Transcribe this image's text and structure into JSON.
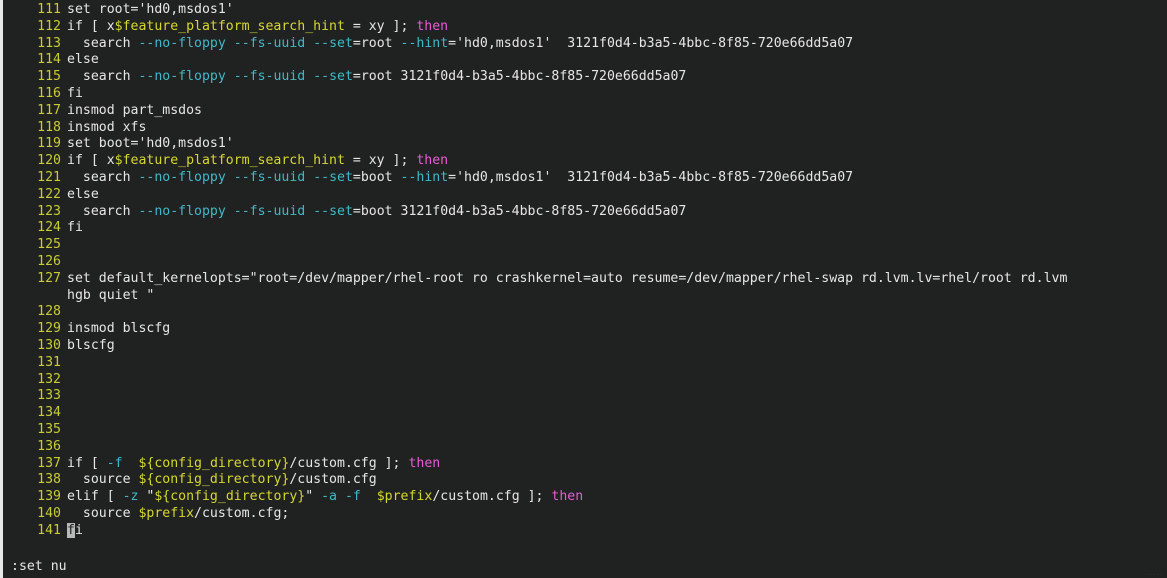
{
  "app": {
    "name": "vim",
    "background_color": "#202221",
    "foreground_color": "#e6e6e6",
    "linenumber_color": "#c9cc35",
    "keyword_color": "#e65bd4",
    "option_color": "#3fb9c9",
    "variable_color": "#d7d72f",
    "cursor_color": "#b8b8b8"
  },
  "statusline": {
    "command": ":set nu"
  },
  "watermark": {
    "text": "....."
  },
  "editor": {
    "first_line_number": 111,
    "cursor_line": 141,
    "cursor_column": 1,
    "lines": [
      {
        "num": "111",
        "spans": [
          {
            "t": "set root='hd0,msdos1'",
            "c": "plain"
          }
        ]
      },
      {
        "num": "112",
        "spans": [
          {
            "t": "if [ x",
            "c": "plain"
          },
          {
            "t": "$feature_platform_search_hint",
            "c": "var"
          },
          {
            "t": " = xy ]; ",
            "c": "plain"
          },
          {
            "t": "then",
            "c": "kw"
          }
        ]
      },
      {
        "num": "113",
        "spans": [
          {
            "t": "  search ",
            "c": "plain"
          },
          {
            "t": "--no-floppy",
            "c": "flag"
          },
          {
            "t": " ",
            "c": "plain"
          },
          {
            "t": "--fs-uuid",
            "c": "flag"
          },
          {
            "t": " ",
            "c": "plain"
          },
          {
            "t": "--set",
            "c": "flag"
          },
          {
            "t": "=root ",
            "c": "plain"
          },
          {
            "t": "--hint",
            "c": "flag"
          },
          {
            "t": "='hd0,msdos1'  3121f0d4-b3a5-4bbc-8f85-720e66dd5a07",
            "c": "plain"
          }
        ]
      },
      {
        "num": "114",
        "spans": [
          {
            "t": "else",
            "c": "plain"
          }
        ]
      },
      {
        "num": "115",
        "spans": [
          {
            "t": "  search ",
            "c": "plain"
          },
          {
            "t": "--no-floppy",
            "c": "flag"
          },
          {
            "t": " ",
            "c": "plain"
          },
          {
            "t": "--fs-uuid",
            "c": "flag"
          },
          {
            "t": " ",
            "c": "plain"
          },
          {
            "t": "--set",
            "c": "flag"
          },
          {
            "t": "=root 3121f0d4-b3a5-4bbc-8f85-720e66dd5a07",
            "c": "plain"
          }
        ]
      },
      {
        "num": "116",
        "spans": [
          {
            "t": "fi",
            "c": "plain"
          }
        ]
      },
      {
        "num": "117",
        "spans": [
          {
            "t": "insmod part_msdos",
            "c": "plain"
          }
        ]
      },
      {
        "num": "118",
        "spans": [
          {
            "t": "insmod xfs",
            "c": "plain"
          }
        ]
      },
      {
        "num": "119",
        "spans": [
          {
            "t": "set boot='hd0,msdos1'",
            "c": "plain"
          }
        ]
      },
      {
        "num": "120",
        "spans": [
          {
            "t": "if [ x",
            "c": "plain"
          },
          {
            "t": "$feature_platform_search_hint",
            "c": "var"
          },
          {
            "t": " = xy ]; ",
            "c": "plain"
          },
          {
            "t": "then",
            "c": "kw"
          }
        ]
      },
      {
        "num": "121",
        "spans": [
          {
            "t": "  search ",
            "c": "plain"
          },
          {
            "t": "--no-floppy",
            "c": "flag"
          },
          {
            "t": " ",
            "c": "plain"
          },
          {
            "t": "--fs-uuid",
            "c": "flag"
          },
          {
            "t": " ",
            "c": "plain"
          },
          {
            "t": "--set",
            "c": "flag"
          },
          {
            "t": "=boot ",
            "c": "plain"
          },
          {
            "t": "--hint",
            "c": "flag"
          },
          {
            "t": "='hd0,msdos1'  3121f0d4-b3a5-4bbc-8f85-720e66dd5a07",
            "c": "plain"
          }
        ]
      },
      {
        "num": "122",
        "spans": [
          {
            "t": "else",
            "c": "plain"
          }
        ]
      },
      {
        "num": "123",
        "spans": [
          {
            "t": "  search ",
            "c": "plain"
          },
          {
            "t": "--no-floppy",
            "c": "flag"
          },
          {
            "t": " ",
            "c": "plain"
          },
          {
            "t": "--fs-uuid",
            "c": "flag"
          },
          {
            "t": " ",
            "c": "plain"
          },
          {
            "t": "--set",
            "c": "flag"
          },
          {
            "t": "=boot 3121f0d4-b3a5-4bbc-8f85-720e66dd5a07",
            "c": "plain"
          }
        ]
      },
      {
        "num": "124",
        "spans": [
          {
            "t": "fi",
            "c": "plain"
          }
        ]
      },
      {
        "num": "125",
        "spans": []
      },
      {
        "num": "126",
        "spans": []
      },
      {
        "num": "127",
        "spans": [
          {
            "t": "set default_kernelopts=\"root=/dev/mapper/rhel-root ro crashkernel=auto resume=/dev/mapper/rhel-swap rd.lvm.lv=rhel/root rd.lvm",
            "c": "plain"
          }
        ]
      },
      {
        "num": "",
        "wrapped": true,
        "spans": [
          {
            "t": "hgb quiet \"",
            "c": "plain"
          }
        ]
      },
      {
        "num": "128",
        "spans": []
      },
      {
        "num": "129",
        "spans": [
          {
            "t": "insmod blscfg",
            "c": "plain"
          }
        ]
      },
      {
        "num": "130",
        "spans": [
          {
            "t": "blscfg",
            "c": "plain"
          }
        ]
      },
      {
        "num": "131",
        "spans": []
      },
      {
        "num": "132",
        "spans": []
      },
      {
        "num": "133",
        "spans": []
      },
      {
        "num": "134",
        "spans": []
      },
      {
        "num": "135",
        "spans": []
      },
      {
        "num": "136",
        "spans": []
      },
      {
        "num": "137",
        "spans": [
          {
            "t": "if [ ",
            "c": "plain"
          },
          {
            "t": "-f",
            "c": "flag"
          },
          {
            "t": "  ",
            "c": "plain"
          },
          {
            "t": "${config_directory}",
            "c": "var"
          },
          {
            "t": "/custom.cfg ]; ",
            "c": "plain"
          },
          {
            "t": "then",
            "c": "kw"
          }
        ]
      },
      {
        "num": "138",
        "spans": [
          {
            "t": "  source ",
            "c": "plain"
          },
          {
            "t": "${config_directory}",
            "c": "var"
          },
          {
            "t": "/custom.cfg",
            "c": "plain"
          }
        ]
      },
      {
        "num": "139",
        "spans": [
          {
            "t": "elif [ ",
            "c": "plain"
          },
          {
            "t": "-z",
            "c": "flag"
          },
          {
            "t": " \"",
            "c": "plain"
          },
          {
            "t": "${config_directory}",
            "c": "var"
          },
          {
            "t": "\" ",
            "c": "plain"
          },
          {
            "t": "-a",
            "c": "flag"
          },
          {
            "t": " ",
            "c": "plain"
          },
          {
            "t": "-f",
            "c": "flag"
          },
          {
            "t": "  ",
            "c": "plain"
          },
          {
            "t": "$prefix",
            "c": "var"
          },
          {
            "t": "/custom.cfg ]; ",
            "c": "plain"
          },
          {
            "t": "then",
            "c": "kw"
          }
        ]
      },
      {
        "num": "140",
        "spans": [
          {
            "t": "  source ",
            "c": "plain"
          },
          {
            "t": "$prefix",
            "c": "var"
          },
          {
            "t": "/custom.cfg;",
            "c": "plain"
          }
        ]
      },
      {
        "num": "141",
        "spans": [
          {
            "t": "f",
            "c": "plain",
            "cursor": true
          },
          {
            "t": "i",
            "c": "plain"
          }
        ]
      }
    ]
  }
}
